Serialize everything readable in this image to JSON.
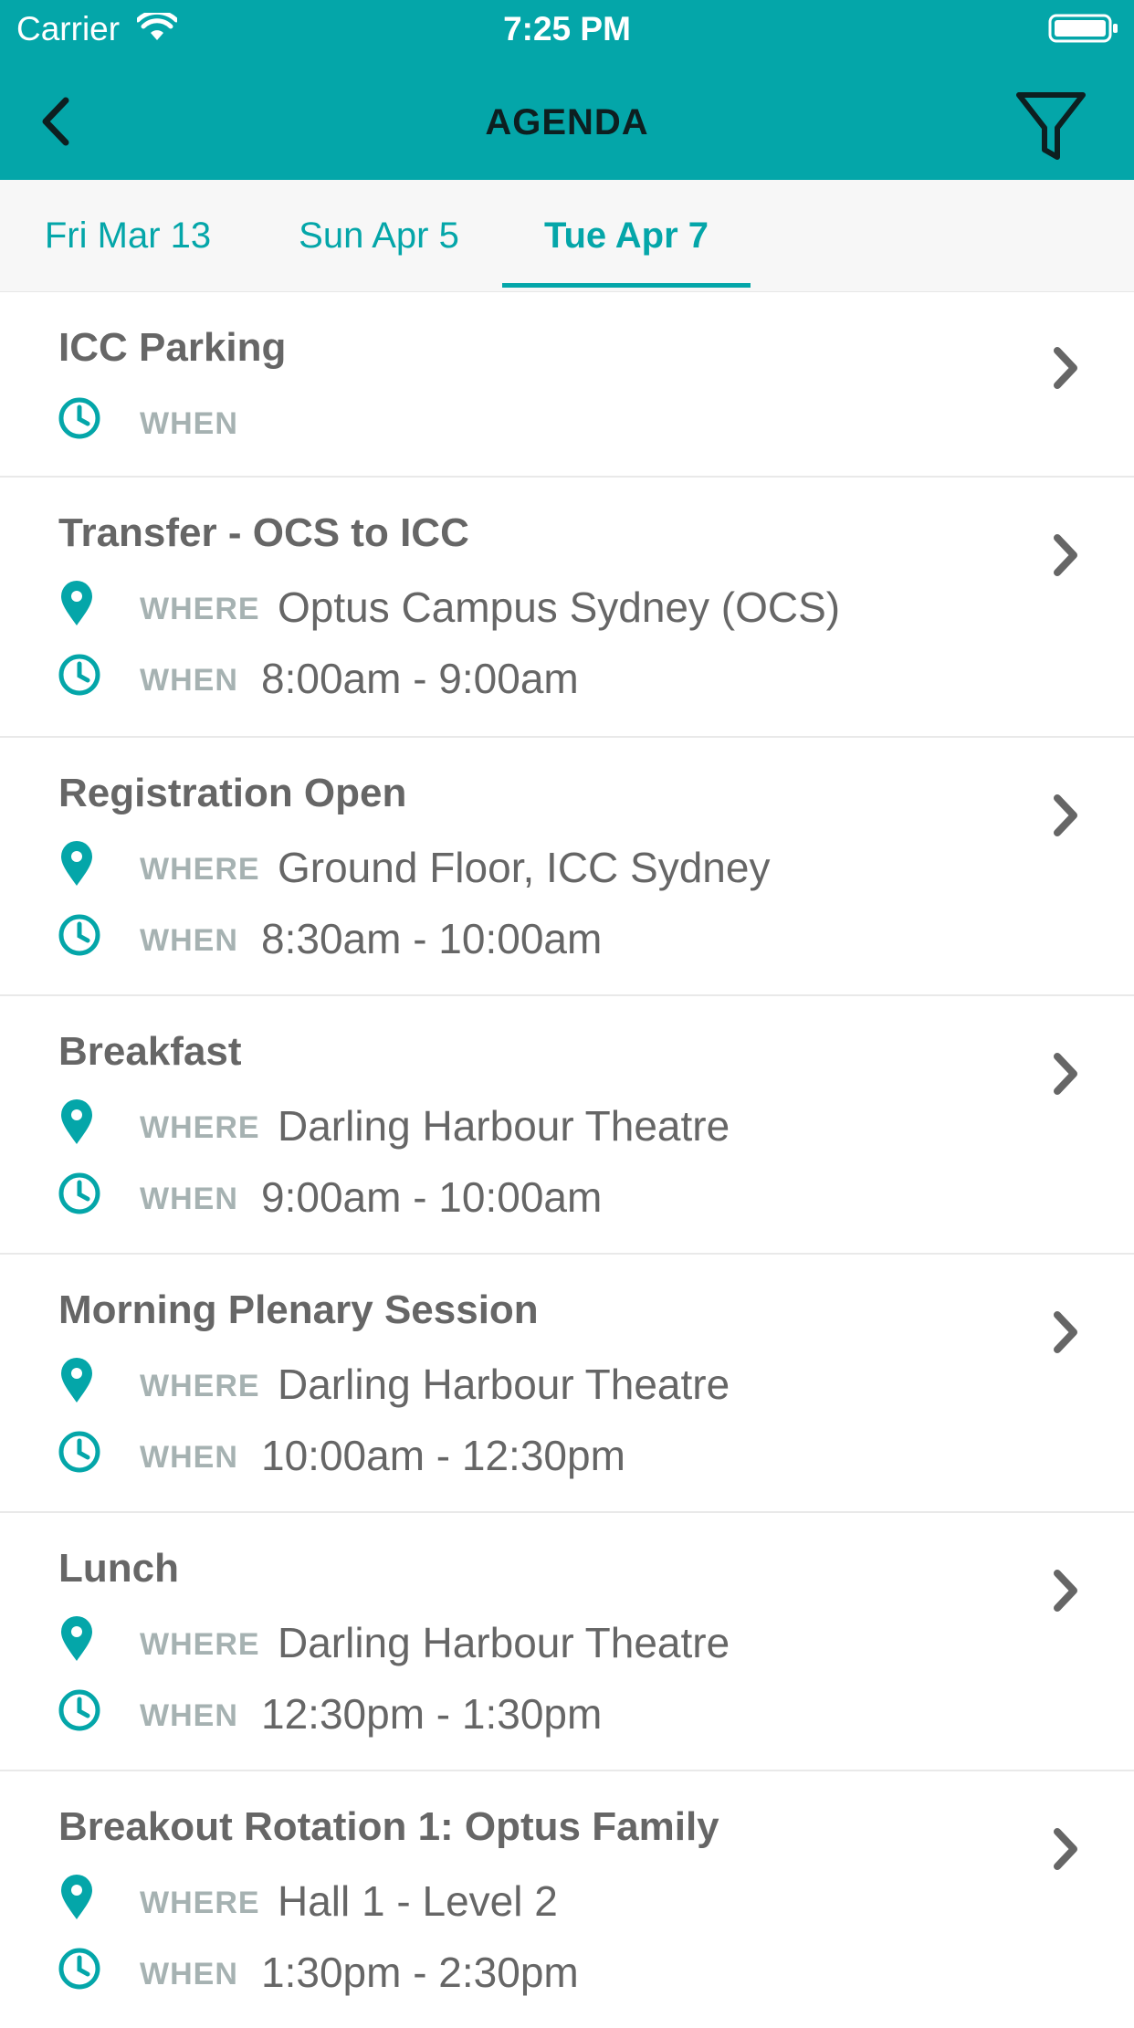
{
  "status_bar": {
    "carrier": "Carrier",
    "time": "7:25 PM"
  },
  "header": {
    "title": "AGENDA"
  },
  "colors": {
    "accent": "#04A6A9",
    "text": "#666666",
    "label": "#a6b2b2"
  },
  "tabs": [
    {
      "label": "Fri Mar 13",
      "active": false
    },
    {
      "label": "Sun Apr 5",
      "active": false
    },
    {
      "label": "Tue Apr 7",
      "active": true
    }
  ],
  "labels": {
    "where": "WHERE",
    "when": "WHEN"
  },
  "agenda": [
    {
      "title": "ICC Parking",
      "where": "",
      "when": ""
    },
    {
      "title": "Transfer - OCS to ICC",
      "where": "Optus Campus Sydney (OCS)",
      "when": "8:00am - 9:00am"
    },
    {
      "title": "Registration Open",
      "where": "Ground Floor, ICC Sydney",
      "when": "8:30am - 10:00am"
    },
    {
      "title": "Breakfast",
      "where": "Darling Harbour Theatre",
      "when": "9:00am - 10:00am"
    },
    {
      "title": "Morning Plenary Session",
      "where": "Darling Harbour Theatre",
      "when": "10:00am - 12:30pm"
    },
    {
      "title": "Lunch",
      "where": "Darling Harbour Theatre",
      "when": "12:30pm - 1:30pm"
    },
    {
      "title": "Breakout Rotation 1: Optus Family",
      "where": "Hall 1 - Level 2",
      "when": "1:30pm - 2:30pm"
    }
  ]
}
